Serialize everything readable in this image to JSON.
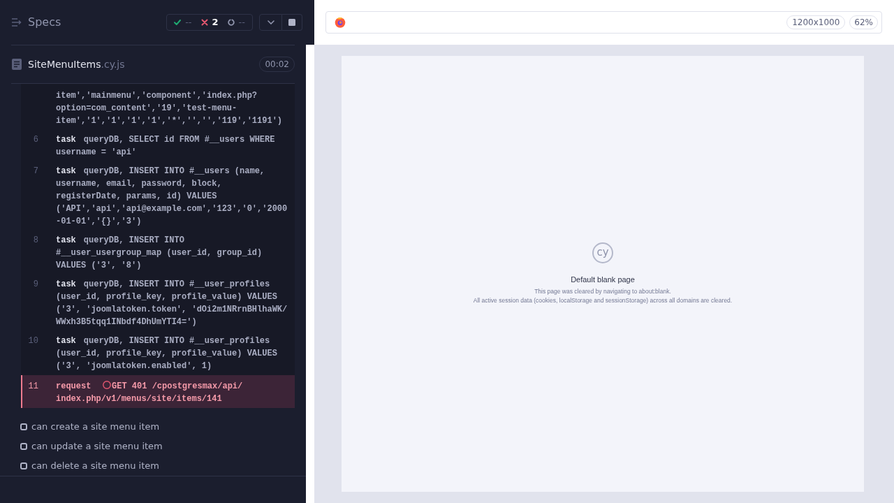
{
  "reporter": {
    "title": "Specs",
    "stats": [
      {
        "kind": "passed",
        "count": "--"
      },
      {
        "kind": "failed",
        "count": "2"
      },
      {
        "kind": "pending",
        "count": "--"
      }
    ],
    "spec": {
      "name": "SiteMenuItems",
      "extension": ".cy.js",
      "duration": "00:02"
    },
    "command_log": [
      {
        "kind": "task",
        "failed": false,
        "message": "item','mainmenu','component','index.php?option=com_content','19','test-menu-item','1','1','1','1','*','','','119','1191')"
      },
      {
        "kind": "task",
        "failed": false,
        "number": "6",
        "name": "task",
        "message": "queryDB, SELECT id FROM #__users WHERE username = 'api'"
      },
      {
        "kind": "task",
        "failed": false,
        "number": "7",
        "name": "task",
        "message": "queryDB, INSERT INTO #__users (name, username, email, password, block, registerDate, params, id) VALUES ('API','api','api@example.com','123','0','2000-01-01','{}','3')"
      },
      {
        "kind": "task",
        "failed": false,
        "number": "8",
        "name": "task",
        "message": "queryDB, INSERT INTO #__user_usergroup_map (user_id, group_id) VALUES ('3', '8')"
      },
      {
        "kind": "task",
        "failed": false,
        "number": "9",
        "name": "task",
        "message": "queryDB, INSERT INTO #__user_profiles (user_id, profile_key, profile_value) VALUES ('3', 'joomlatoken.token', 'dOi2m1NRrnBHlhaWK/WWxh3B5tqq1INbdf4DhUmYTI4=')"
      },
      {
        "kind": "task",
        "failed": false,
        "number": "10",
        "name": "task",
        "message": "queryDB, INSERT INTO #__user_profiles (user_id, profile_key, profile_value) VALUES ('3', 'joomlatoken.enabled', 1)"
      },
      {
        "kind": "request",
        "failed": true,
        "number": "11",
        "name": "request",
        "message": "GET 401 /cpostgresmax/api/index.php/v1/menus/site/items/141"
      }
    ],
    "tests": [
      {
        "title": "can create a site menu item"
      },
      {
        "title": "can update a site menu item"
      },
      {
        "title": "can delete a site menu item"
      }
    ]
  },
  "browser": {
    "viewport": "1200x1000",
    "zoom": "62%",
    "page": {
      "logo": "cy",
      "title": "Default blank page",
      "lines": [
        "This page was cleared by navigating to about:blank.",
        "All active session data (cookies, localStorage and sessionStorage) across all domains are cleared."
      ]
    }
  }
}
